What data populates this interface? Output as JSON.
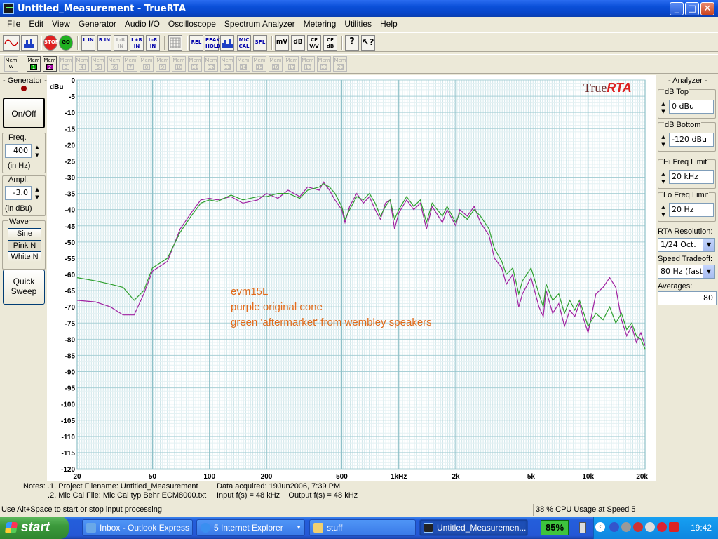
{
  "window": {
    "title": "Untitled_Measurement - TrueRTA"
  },
  "menu": [
    "File",
    "Edit",
    "View",
    "Generator",
    "Audio I/O",
    "Oscilloscope",
    "Spectrum Analyzer",
    "Metering",
    "Utilities",
    "Help"
  ],
  "toolbar": {
    "stop": "STOP",
    "go": "GO",
    "l_in": "L IN",
    "r_in": "R IN",
    "lr_in": "L-R IN",
    "lpr_in": "L+R IN",
    "lmr_in": "L-R IN",
    "rel": "REL",
    "peak_hold": "PEAK HOLD",
    "mic_cal": "MIC CAL",
    "spl": "SPL",
    "mv": "mV",
    "db": "dB",
    "cf_vv": "CF V/V",
    "cf_db": "CF dB"
  },
  "memory": {
    "w_label": "Mem W",
    "buttons": [
      "1",
      "2",
      "3",
      "4",
      "5",
      "6",
      "7",
      "8",
      "9",
      "10",
      "11",
      "12",
      "13",
      "14",
      "15",
      "16",
      "17",
      "18",
      "19",
      "20"
    ],
    "prefix": "Mem",
    "active_colors": {
      "1": "#00a000",
      "2": "#a000a0"
    }
  },
  "generator": {
    "title": "- Generator -",
    "on_off": "On/Off",
    "freq_label": "Freq.",
    "freq_value": "400",
    "freq_unit": "(in Hz)",
    "ampl_label": "Ampl.",
    "ampl_value": "-3.0",
    "ampl_unit": "(in dBu)",
    "wave_label": "Wave",
    "sine": "Sine",
    "pink": "Pink N",
    "white": "White N",
    "quick_sweep_1": "Quick",
    "quick_sweep_2": "Sweep"
  },
  "analyzer": {
    "title": "- Analyzer -",
    "db_top_label": "dB Top",
    "db_top": "0 dBu",
    "db_bottom_label": "dB Bottom",
    "db_bottom": "-120 dBu",
    "hi_label": "Hi Freq Limit",
    "hi": "20 kHz",
    "lo_label": "Lo Freq Limit",
    "lo": "20 Hz",
    "res_label": "RTA Resolution:",
    "res": "1/24 Oct.",
    "speed_label": "Speed Tradeoff:",
    "speed": "80 Hz (fast)",
    "avg_label": "Averages:",
    "avg": "80"
  },
  "chart_data": {
    "type": "line",
    "ylabel": "dBu",
    "ylim": [
      -120,
      0
    ],
    "xscale": "log",
    "xlim": [
      20,
      20000
    ],
    "yticks": [
      "0",
      "-5",
      "-10",
      "-15",
      "-20",
      "-25",
      "-30",
      "-35",
      "-40",
      "-45",
      "-50",
      "-55",
      "-60",
      "-65",
      "-70",
      "-75",
      "-80",
      "-85",
      "-90",
      "-95",
      "-100",
      "-105",
      "-110",
      "-115",
      "-120"
    ],
    "xticks": [
      {
        "v": 20,
        "t": "20"
      },
      {
        "v": 50,
        "t": "50"
      },
      {
        "v": 100,
        "t": "100"
      },
      {
        "v": 200,
        "t": "200"
      },
      {
        "v": 500,
        "t": "500"
      },
      {
        "v": 1000,
        "t": "1kHz"
      },
      {
        "v": 2000,
        "t": "2k"
      },
      {
        "v": 5000,
        "t": "5k"
      },
      {
        "v": 10000,
        "t": "10k"
      },
      {
        "v": 20000,
        "t": "20k"
      }
    ],
    "logo_plain": "True",
    "logo_accent": "RTA",
    "annotation": [
      "evm15L",
      "purple original cone",
      "green 'aftermarket' from wembley speakers"
    ],
    "series": [
      {
        "color": "#a020a0",
        "points": [
          [
            20,
            -68
          ],
          [
            25,
            -68.5
          ],
          [
            30,
            -70
          ],
          [
            35,
            -72.5
          ],
          [
            40,
            -72.5
          ],
          [
            45,
            -66
          ],
          [
            50,
            -59
          ],
          [
            60,
            -56
          ],
          [
            70,
            -46
          ],
          [
            80,
            -41
          ],
          [
            90,
            -37
          ],
          [
            100,
            -36.5
          ],
          [
            110,
            -37
          ],
          [
            130,
            -36
          ],
          [
            150,
            -38
          ],
          [
            180,
            -37
          ],
          [
            200,
            -35
          ],
          [
            230,
            -36.5
          ],
          [
            260,
            -34
          ],
          [
            300,
            -36
          ],
          [
            330,
            -33
          ],
          [
            380,
            -34
          ],
          [
            400,
            -31.5
          ],
          [
            430,
            -34
          ],
          [
            460,
            -37
          ],
          [
            500,
            -40
          ],
          [
            520,
            -44
          ],
          [
            550,
            -39
          ],
          [
            600,
            -35
          ],
          [
            650,
            -38
          ],
          [
            700,
            -36
          ],
          [
            750,
            -40
          ],
          [
            800,
            -43
          ],
          [
            850,
            -38
          ],
          [
            900,
            -37
          ],
          [
            950,
            -46
          ],
          [
            1000,
            -41
          ],
          [
            1100,
            -37
          ],
          [
            1200,
            -40
          ],
          [
            1300,
            -38
          ],
          [
            1400,
            -46
          ],
          [
            1500,
            -39
          ],
          [
            1700,
            -44
          ],
          [
            1800,
            -40
          ],
          [
            2000,
            -45
          ],
          [
            2100,
            -40
          ],
          [
            2300,
            -42
          ],
          [
            2500,
            -39
          ],
          [
            2700,
            -44
          ],
          [
            3000,
            -48
          ],
          [
            3200,
            -55
          ],
          [
            3500,
            -58
          ],
          [
            3700,
            -63
          ],
          [
            4000,
            -60
          ],
          [
            4300,
            -70
          ],
          [
            4500,
            -66
          ],
          [
            5000,
            -61
          ],
          [
            5500,
            -70
          ],
          [
            5800,
            -73
          ],
          [
            6000,
            -65
          ],
          [
            6500,
            -72
          ],
          [
            7000,
            -69
          ],
          [
            7500,
            -76
          ],
          [
            8000,
            -71
          ],
          [
            8500,
            -73
          ],
          [
            9000,
            -69
          ],
          [
            9500,
            -74
          ],
          [
            10000,
            -78
          ],
          [
            11000,
            -66
          ],
          [
            12000,
            -64
          ],
          [
            13000,
            -61
          ],
          [
            14000,
            -64
          ],
          [
            15000,
            -74
          ],
          [
            16000,
            -79
          ],
          [
            17000,
            -76
          ],
          [
            18000,
            -81
          ],
          [
            19000,
            -78
          ],
          [
            20000,
            -82
          ]
        ]
      },
      {
        "color": "#30a030",
        "points": [
          [
            20,
            -61
          ],
          [
            25,
            -62
          ],
          [
            30,
            -63
          ],
          [
            35,
            -64
          ],
          [
            40,
            -68
          ],
          [
            45,
            -65
          ],
          [
            50,
            -58
          ],
          [
            60,
            -55
          ],
          [
            70,
            -47
          ],
          [
            80,
            -42
          ],
          [
            90,
            -38
          ],
          [
            100,
            -37
          ],
          [
            110,
            -37.5
          ],
          [
            130,
            -35.5
          ],
          [
            150,
            -37
          ],
          [
            180,
            -36
          ],
          [
            200,
            -36
          ],
          [
            230,
            -35
          ],
          [
            260,
            -35
          ],
          [
            300,
            -36.5
          ],
          [
            330,
            -34
          ],
          [
            380,
            -33
          ],
          [
            400,
            -32
          ],
          [
            430,
            -33
          ],
          [
            460,
            -35
          ],
          [
            500,
            -39
          ],
          [
            520,
            -43
          ],
          [
            550,
            -40
          ],
          [
            600,
            -36
          ],
          [
            650,
            -37
          ],
          [
            700,
            -35
          ],
          [
            750,
            -38
          ],
          [
            800,
            -42
          ],
          [
            850,
            -39
          ],
          [
            900,
            -37
          ],
          [
            950,
            -43
          ],
          [
            1000,
            -40
          ],
          [
            1100,
            -36
          ],
          [
            1200,
            -39
          ],
          [
            1300,
            -37
          ],
          [
            1400,
            -44
          ],
          [
            1500,
            -38
          ],
          [
            1700,
            -42
          ],
          [
            1800,
            -39
          ],
          [
            2000,
            -44
          ],
          [
            2100,
            -41
          ],
          [
            2300,
            -43
          ],
          [
            2500,
            -40
          ],
          [
            2700,
            -42
          ],
          [
            3000,
            -46
          ],
          [
            3200,
            -52
          ],
          [
            3500,
            -56
          ],
          [
            3700,
            -60
          ],
          [
            4000,
            -58
          ],
          [
            4300,
            -66
          ],
          [
            4500,
            -62
          ],
          [
            5000,
            -58
          ],
          [
            5500,
            -66
          ],
          [
            5800,
            -70
          ],
          [
            6000,
            -63
          ],
          [
            6500,
            -68
          ],
          [
            7000,
            -66
          ],
          [
            7500,
            -72
          ],
          [
            8000,
            -68
          ],
          [
            8500,
            -71
          ],
          [
            9000,
            -68
          ],
          [
            9500,
            -72
          ],
          [
            10000,
            -76
          ],
          [
            11000,
            -72
          ],
          [
            12000,
            -74
          ],
          [
            13000,
            -70
          ],
          [
            14000,
            -75
          ],
          [
            15000,
            -72
          ],
          [
            16000,
            -77
          ],
          [
            17000,
            -75
          ],
          [
            18000,
            -79
          ],
          [
            19000,
            -80
          ],
          [
            20000,
            -83
          ]
        ]
      }
    ]
  },
  "notes": {
    "label": "Notes:",
    "line1": ".1. Project Filename: Untitled_Measurement",
    "line2": ".2. Mic Cal File: Mic Cal typ Behr ECM8000.txt",
    "data1": "Data acquired: 19Jun2006, 7:39 PM",
    "data2": "Input f(s) = 48 kHz    Output f(s) = 48 kHz"
  },
  "status": {
    "left": "Use Alt+Space to start or stop input processing",
    "cpu": "38 % CPU Usage at Speed 5"
  },
  "taskbar": {
    "start": "start",
    "tasks": [
      "Inbox - Outlook Express",
      "5 Internet Explorer",
      "stuff",
      "Untitled_Measuremen..."
    ],
    "battery": "85%",
    "clock": "19:42"
  }
}
